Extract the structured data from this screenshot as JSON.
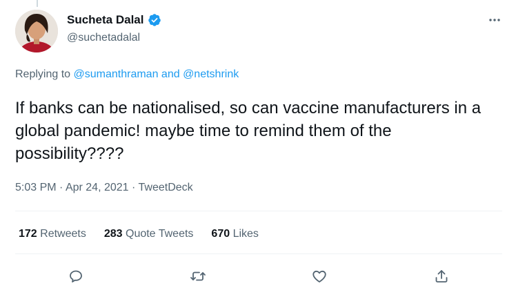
{
  "author": {
    "display_name": "Sucheta Dalal",
    "handle": "@suchetadalal",
    "verified": true
  },
  "reply": {
    "prefix": "Replying to ",
    "user1": "@sumanthraman",
    "conjunction": " and ",
    "user2": "@netshrink"
  },
  "tweet": {
    "text": "If banks can be nationalised, so can vaccine manufacturers in a global pandemic! maybe time to remind them of the possibility????"
  },
  "meta": {
    "time": "5:03 PM",
    "separator1": " · ",
    "date": "Apr 24, 2021",
    "separator2": " · ",
    "source": "TweetDeck"
  },
  "stats": {
    "retweets_count": "172",
    "retweets_label": " Retweets",
    "quotes_count": "283",
    "quotes_label": " Quote Tweets",
    "likes_count": "670",
    "likes_label": " Likes"
  },
  "icons": {
    "verified": "verified-badge-icon",
    "more": "more-dots-icon",
    "reply": "reply-icon",
    "retweet": "retweet-icon",
    "like": "heart-icon",
    "share": "share-icon"
  },
  "colors": {
    "accent": "#1d9bf0",
    "text_primary": "#0f1419",
    "text_secondary": "#536471",
    "divider": "#eff3f4"
  }
}
